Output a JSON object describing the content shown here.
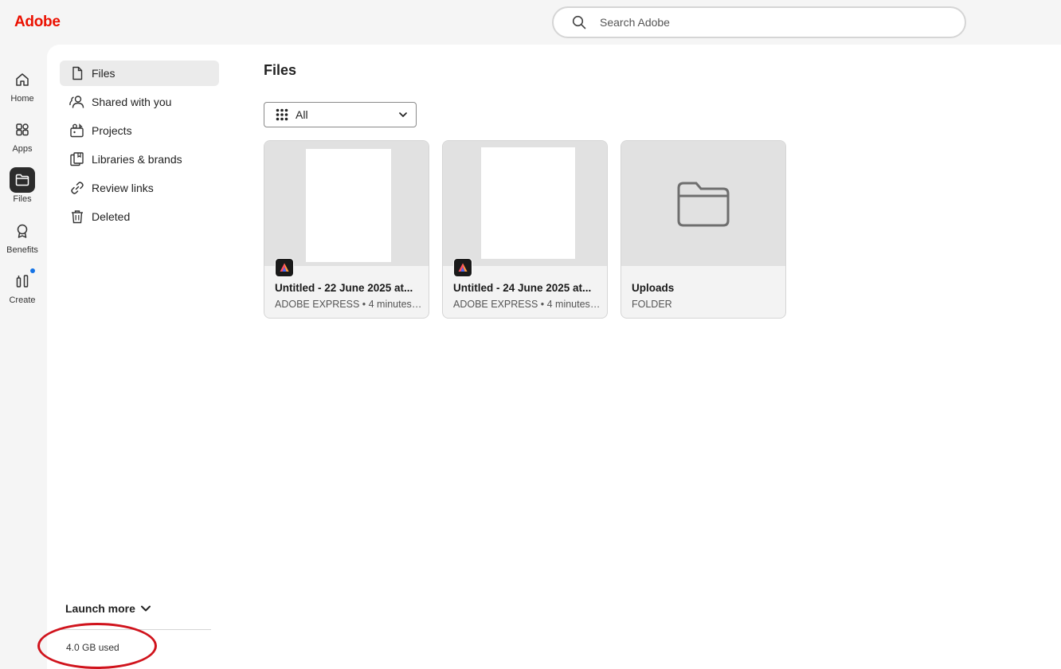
{
  "header": {
    "logo": "Adobe",
    "search_placeholder": "Search Adobe"
  },
  "rail": {
    "items": [
      {
        "label": "Home",
        "icon": "home-icon"
      },
      {
        "label": "Apps",
        "icon": "apps-icon"
      },
      {
        "label": "Files",
        "icon": "folder-icon",
        "active": true
      },
      {
        "label": "Benefits",
        "icon": "award-icon"
      },
      {
        "label": "Create",
        "icon": "create-icon",
        "notification": true
      }
    ]
  },
  "sidebar": {
    "items": [
      {
        "label": "Files",
        "icon": "file-icon",
        "active": true
      },
      {
        "label": "Shared with you",
        "icon": "people-icon"
      },
      {
        "label": "Projects",
        "icon": "projects-icon"
      },
      {
        "label": "Libraries & brands",
        "icon": "libraries-icon"
      },
      {
        "label": "Review links",
        "icon": "link-icon"
      },
      {
        "label": "Deleted",
        "icon": "trash-icon"
      }
    ],
    "launch_more": "Launch more",
    "storage": "4.0 GB used"
  },
  "main": {
    "title": "Files",
    "filter": {
      "selected": "All"
    },
    "cards": [
      {
        "title": "Untitled - 22 June 2025 at...",
        "subtitle": "ADOBE EXPRESS • 4 minutes ...",
        "type": "file"
      },
      {
        "title": "Untitled - 24 June 2025 at...",
        "subtitle": "ADOBE EXPRESS • 4 minutes ...",
        "type": "file"
      },
      {
        "title": "Uploads",
        "subtitle": "FOLDER",
        "type": "folder"
      }
    ]
  },
  "colors": {
    "brand": "#eb1000",
    "accent": "#1473e6",
    "highlight": "#d0131c"
  }
}
